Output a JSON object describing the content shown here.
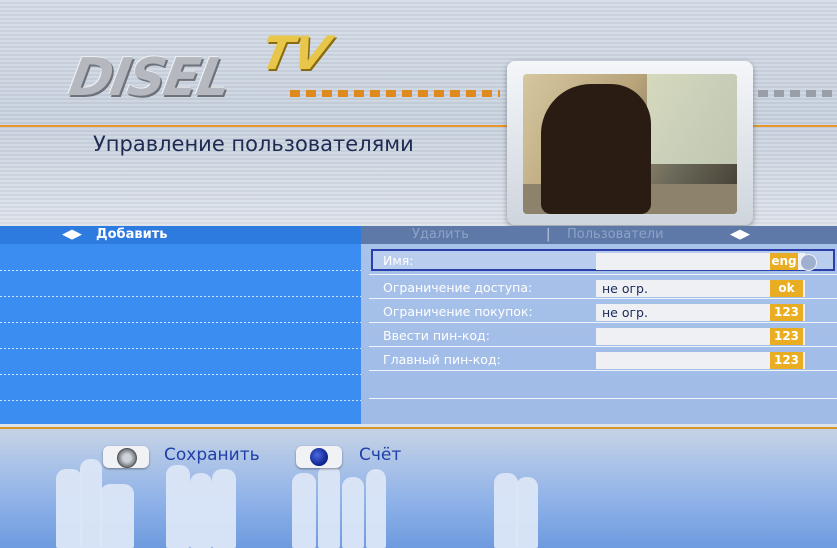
{
  "header": {
    "logo_main": "DISEL",
    "logo_accent": "TV",
    "title": "Управление пользователями"
  },
  "menu": {
    "add": "Добавить",
    "delete": "Удалить",
    "users": "Пользователи",
    "arrows_icon": "◀▶"
  },
  "form": {
    "name_label": "Имя:",
    "name_value": "",
    "name_tag": "eng",
    "access_label": "Ограничение доступа:",
    "access_value": "не огр.",
    "access_tag": "ok",
    "purchase_label": "Ограничение покупок:",
    "purchase_value": "не огр.",
    "purchase_tag": "123",
    "enter_pin_label": "Ввести пин-код:",
    "enter_pin_value": "",
    "enter_pin_tag": "123",
    "master_pin_label": "Главный пин-код:",
    "master_pin_value": "",
    "master_pin_tag": "123"
  },
  "footer": {
    "save_label": "Сохранить",
    "account_label": "Счёт"
  },
  "colors": {
    "accent_orange": "#e8952a",
    "left_panel": "#3b8df2",
    "tag_yellow": "#e8ad23"
  }
}
